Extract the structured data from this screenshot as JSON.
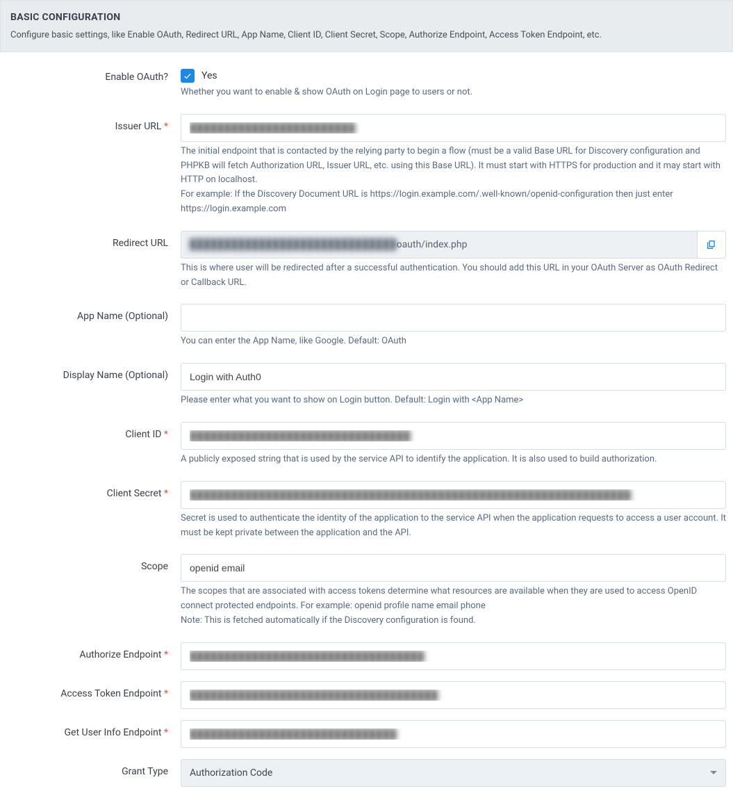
{
  "header": {
    "title": "BASIC CONFIGURATION",
    "subtitle": "Configure basic settings, like Enable OAuth, Redirect URL, App Name, Client ID, Client Secret, Scope, Authorize Endpoint, Access Token Endpoint, etc."
  },
  "fields": {
    "enable_oauth": {
      "label": "Enable OAuth?",
      "checkbox_label": "Yes",
      "checked": true,
      "help": "Whether you want to enable & show OAuth on Login page to users or not."
    },
    "issuer_url": {
      "label": "Issuer URL",
      "required": true,
      "value": "████████████████████████",
      "help": "The initial endpoint that is contacted by the relying party to begin a flow (must be a valid Base URL for Discovery configuration and PHPKB will fetch Authorization URL, Issuer URL, etc. using this Base URL). It must start with HTTPS for production and it may start with HTTP on localhost.\nFor example: If the Discovery Document URL is https://login.example.com/.well-known/openid-configuration then just enter https://login.example.com"
    },
    "redirect_url": {
      "label": "Redirect URL",
      "prefix": "██████████████████████████████",
      "suffix": "oauth/index.php",
      "help": "This is where user will be redirected after a successful authentication. You should add this URL in your OAuth Server as OAuth Redirect or Callback URL."
    },
    "app_name": {
      "label": "App Name (Optional)",
      "value": "",
      "help": "You can enter the App Name, like Google. Default: OAuth"
    },
    "display_name": {
      "label": "Display Name (Optional)",
      "value": "Login with Auth0",
      "help": "Please enter what you want to show on Login button. Default: Login with <App Name>"
    },
    "client_id": {
      "label": "Client ID",
      "required": true,
      "value": "████████████████████████████████",
      "help": "A publicly exposed string that is used by the service API to identify the application. It is also used to build authorization."
    },
    "client_secret": {
      "label": "Client Secret",
      "required": true,
      "value": "████████████████████████████████████████████████████████████████",
      "help": "Secret is used to authenticate the identity of the application to the service API when the application requests to access a user account. It must be kept private between the application and the API."
    },
    "scope": {
      "label": "Scope",
      "value": "openid email",
      "help": "The scopes that are associated with access tokens determine what resources are available when they are used to access OpenID connect protected endpoints. For example: openid profile name email phone\nNote: This is fetched automatically if the Discovery configuration is found."
    },
    "authorize_endpoint": {
      "label": "Authorize Endpoint",
      "required": true,
      "value": "██████████████████████████████████"
    },
    "access_token_endpoint": {
      "label": "Access Token Endpoint",
      "required": true,
      "value": "████████████████████████████████████"
    },
    "user_info_endpoint": {
      "label": "Get User Info Endpoint",
      "required": true,
      "value": "██████████████████████████████"
    },
    "grant_type": {
      "label": "Grant Type",
      "selected": "Authorization Code"
    }
  }
}
